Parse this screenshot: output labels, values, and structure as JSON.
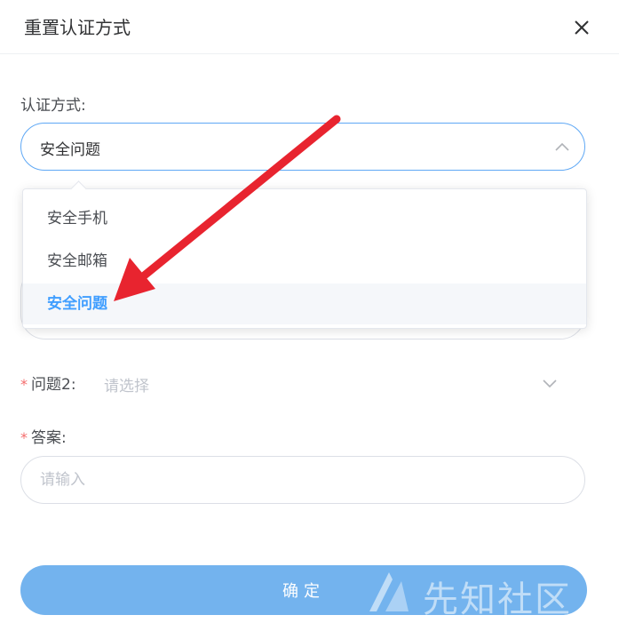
{
  "dialog": {
    "title": "重置认证方式",
    "close_icon": "close-icon"
  },
  "auth_method": {
    "label": "认证方式:",
    "selected_value": "安全问题",
    "border_color": "#5fa8f5"
  },
  "dropdown": {
    "options": [
      {
        "label": "安全手机",
        "selected": false
      },
      {
        "label": "安全邮箱",
        "selected": false
      },
      {
        "label": "安全问题",
        "selected": true
      }
    ],
    "selected_color": "#409eff"
  },
  "question2": {
    "required_mark": "*",
    "label": "问题2:",
    "placeholder": "请选择"
  },
  "answer": {
    "required_mark": "*",
    "label": "答案:",
    "placeholder": "请输入"
  },
  "confirm_button": {
    "label": "确定",
    "color": "#73b3ee"
  },
  "annotation": {
    "arrow_color": "#e8242f"
  },
  "watermark": {
    "text": "先知社区"
  }
}
